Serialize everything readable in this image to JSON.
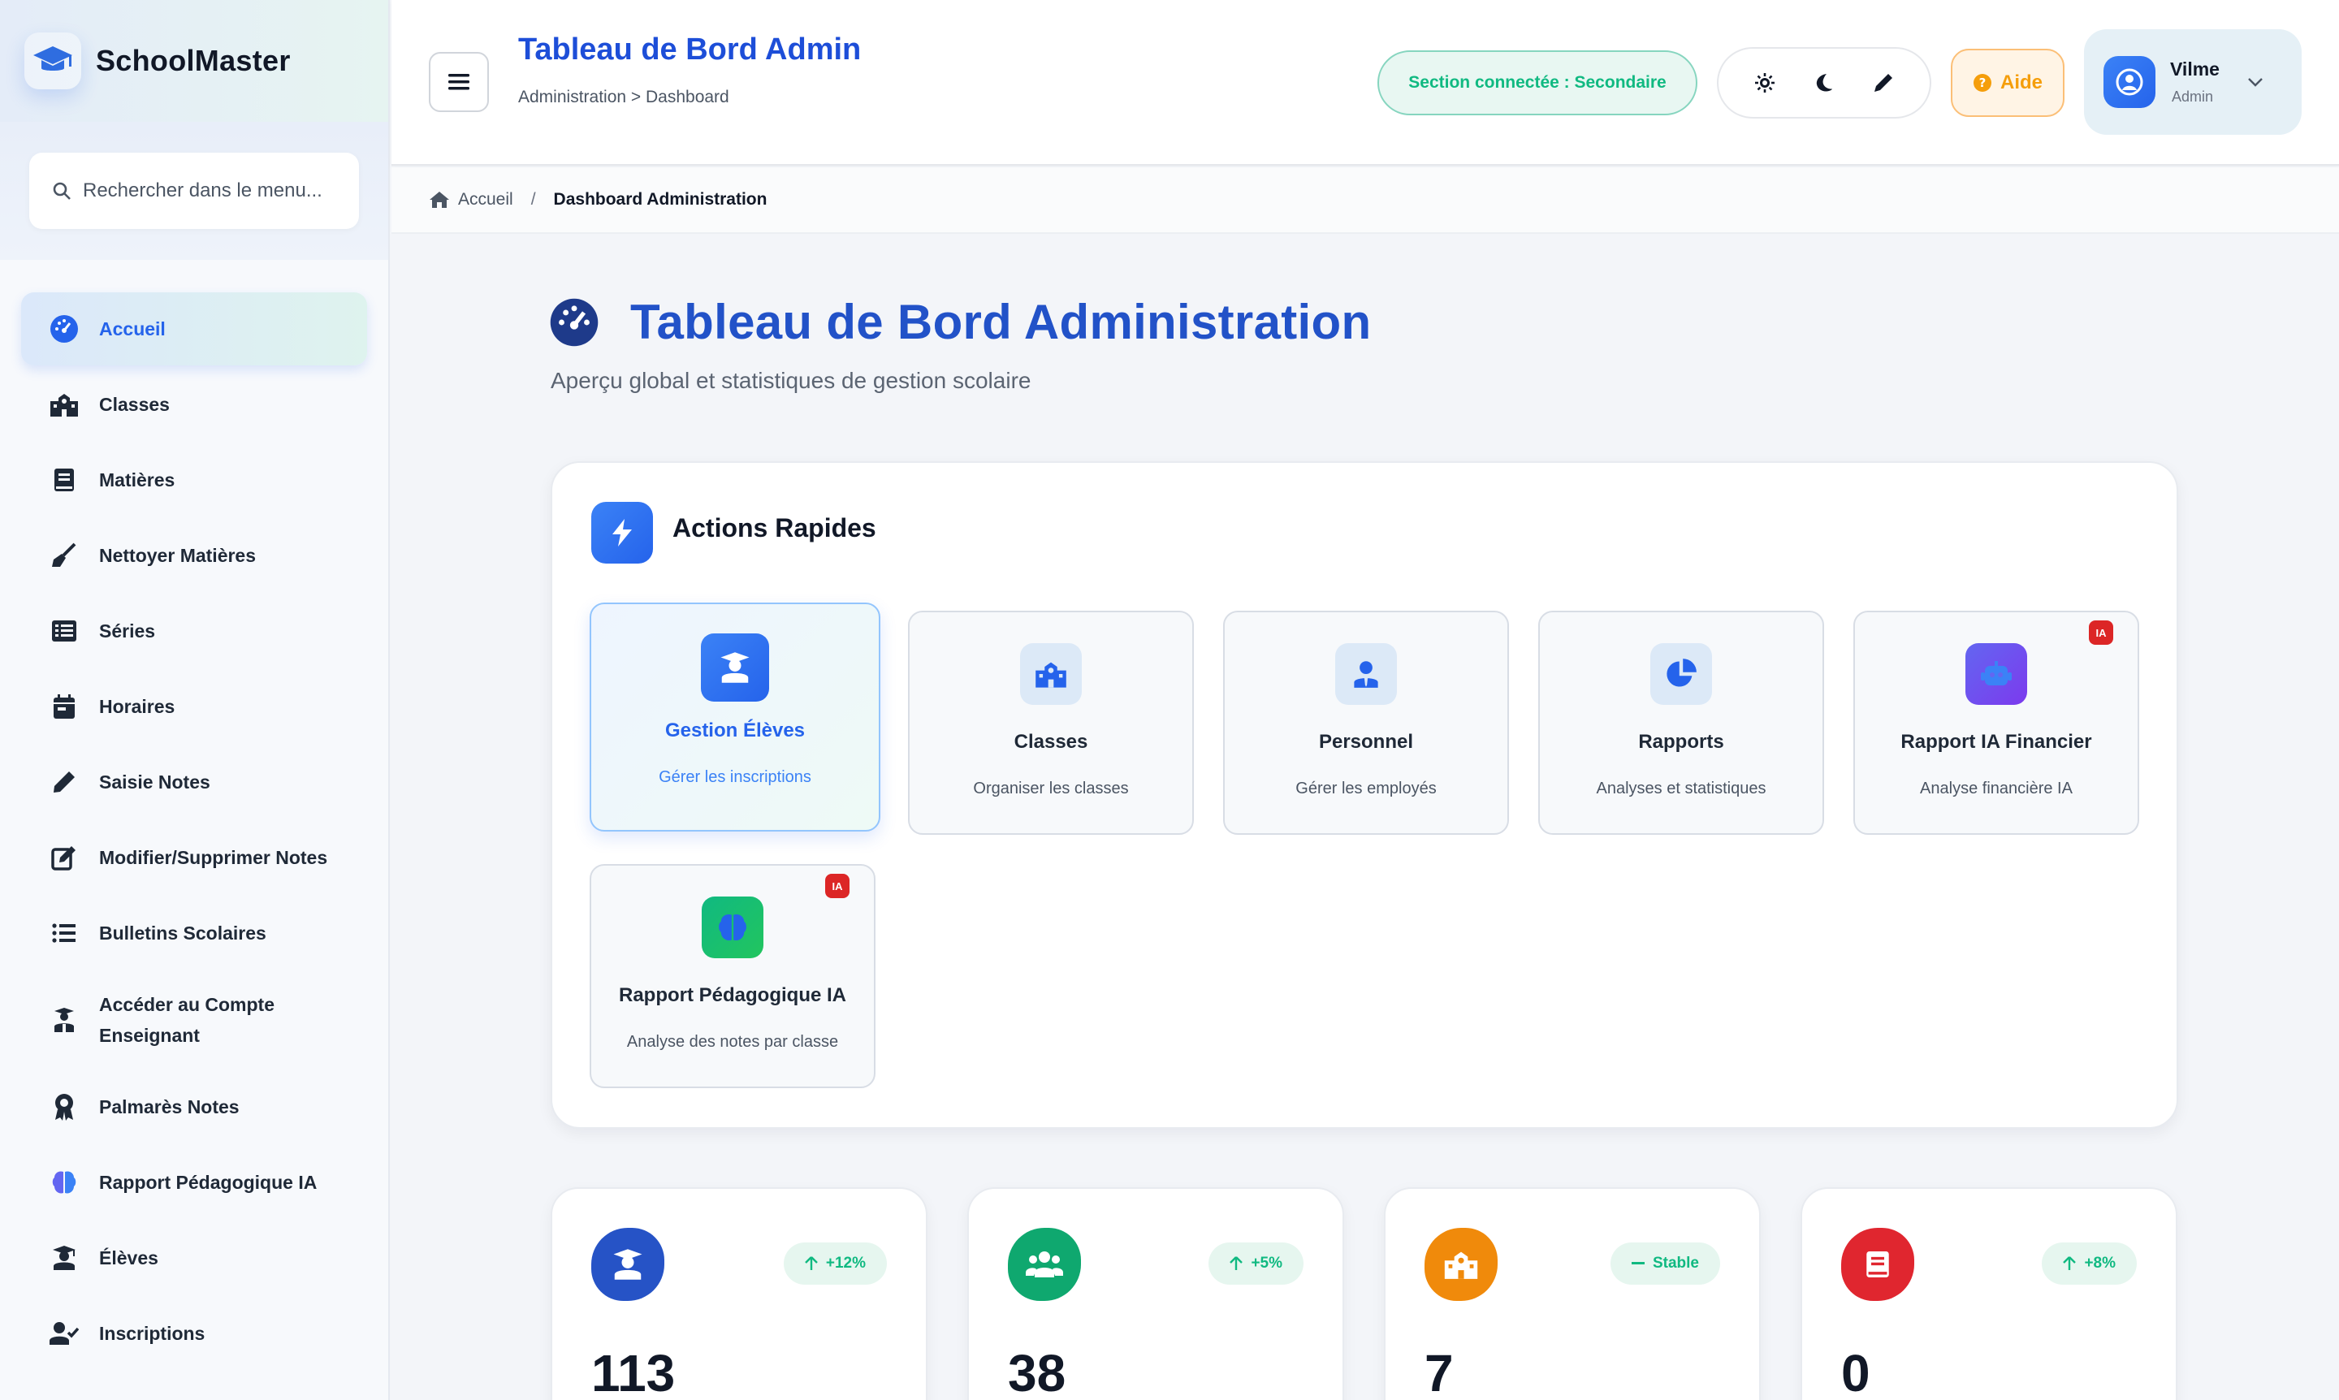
{
  "app": {
    "name": "SchoolMaster"
  },
  "sidebar": {
    "search_placeholder": "Rechercher dans le menu...",
    "items": [
      {
        "label": "Accueil",
        "icon": "dashboard-icon",
        "active": true
      },
      {
        "label": "Classes",
        "icon": "school-icon"
      },
      {
        "label": "Matières",
        "icon": "book-icon"
      },
      {
        "label": "Nettoyer Matières",
        "icon": "broom-icon"
      },
      {
        "label": "Séries",
        "icon": "list-alt-icon"
      },
      {
        "label": "Horaires",
        "icon": "calendar-icon"
      },
      {
        "label": "Saisie Notes",
        "icon": "pencil-icon"
      },
      {
        "label": "Modifier/Supprimer Notes",
        "icon": "edit-icon"
      },
      {
        "label": "Bulletins Scolaires",
        "icon": "list-icon"
      },
      {
        "label": "Accéder au Compte Enseignant",
        "icon": "teacher-icon"
      },
      {
        "label": "Palmarès Notes",
        "icon": "award-icon"
      },
      {
        "label": "Rapport Pédagogique IA",
        "icon": "brain-icon"
      },
      {
        "label": "Élèves",
        "icon": "graduate-icon"
      },
      {
        "label": "Inscriptions",
        "icon": "user-check-icon"
      }
    ]
  },
  "topbar": {
    "title": "Tableau de Bord Admin",
    "breadcrumb": "Administration > Dashboard",
    "section": "Section connectée : Secondaire",
    "help": "Aide",
    "user_name": "Vilme",
    "user_role": "Admin"
  },
  "crumbs": {
    "home": "Accueil",
    "separator": "/",
    "current": "Dashboard Administration"
  },
  "page": {
    "title": "Tableau de Bord Administration",
    "subtitle": "Aperçu global et statistiques de gestion scolaire"
  },
  "quick_actions": {
    "title": "Actions Rapides",
    "tiles": [
      {
        "title": "Gestion Élèves",
        "desc": "Gérer les inscriptions",
        "icon": "graduate-icon"
      },
      {
        "title": "Classes",
        "desc": "Organiser les classes",
        "icon": "school-icon"
      },
      {
        "title": "Personnel",
        "desc": "Gérer les employés",
        "icon": "user-tie-icon"
      },
      {
        "title": "Rapports",
        "desc": "Analyses et statistiques",
        "icon": "pie-chart-icon"
      },
      {
        "title": "Rapport IA Financier",
        "desc": "Analyse financière IA",
        "icon": "robot-icon",
        "badge": "IA"
      },
      {
        "title": "Rapport Pédagogique IA",
        "desc": "Analyse des notes par classe",
        "icon": "brain-icon",
        "badge": "IA"
      }
    ]
  },
  "stats": [
    {
      "value": "113",
      "trend": "+12%",
      "trend_icon": "arrow-up-icon",
      "icon": "graduate-icon",
      "color": "#2563eb"
    },
    {
      "value": "38",
      "trend": "+5%",
      "trend_icon": "arrow-up-icon",
      "icon": "users-icon",
      "color": "#10b981"
    },
    {
      "value": "7",
      "trend": "Stable",
      "trend_icon": "minus-icon",
      "icon": "school-icon",
      "color": "#f59e0b"
    },
    {
      "value": "0",
      "trend": "+8%",
      "trend_icon": "arrow-up-icon",
      "icon": "book-icon",
      "color": "#dc2626"
    }
  ],
  "colors": {
    "primary": "#2563eb",
    "success": "#10b981",
    "warning": "#f59e0b",
    "danger": "#dc2626"
  }
}
